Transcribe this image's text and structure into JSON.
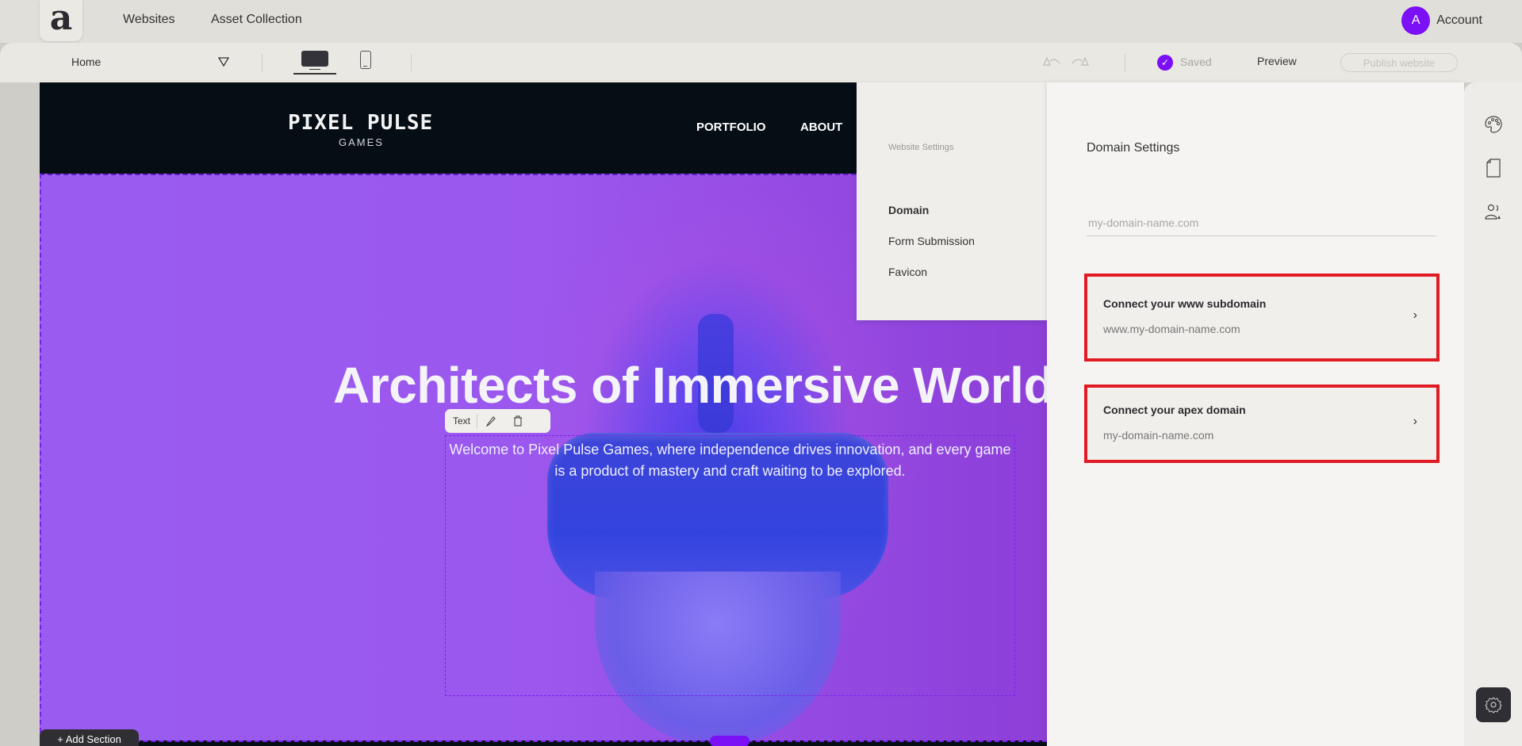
{
  "topnav": {
    "logo_glyph": "a",
    "links": [
      {
        "label": "Websites"
      },
      {
        "label": "Asset Collection"
      }
    ],
    "account": {
      "avatar_initial": "A",
      "label": "Account",
      "avatar_color": "#7b0ff5"
    }
  },
  "toolbar": {
    "page_select": "Home",
    "devices": [
      {
        "name": "desktop",
        "selected": true
      },
      {
        "name": "mobile",
        "selected": false
      }
    ],
    "undo_icon": "undo-icon",
    "redo_icon": "redo-icon",
    "saved_label": "Saved",
    "preview_label": "Preview",
    "publish_label": "Publish website",
    "publish_enabled": false
  },
  "canvas": {
    "site": {
      "logo_main": "PIXEL PULSE",
      "logo_sub": "GAMES",
      "nav": [
        "PORTFOLIO",
        "ABOUT"
      ]
    },
    "hero": {
      "title": "Architects of Immersive Worlds",
      "subtitle": "Welcome to Pixel Pulse Games, where independence drives innovation, and every game is a product of mastery and craft waiting to be explored."
    },
    "text_toolbar": {
      "label": "Text",
      "edit_icon": "pencil-icon",
      "delete_icon": "trash-icon"
    },
    "add_section_label": "+ Add Section"
  },
  "settings": {
    "heading": "Website Settings",
    "items": [
      {
        "label": "Domain",
        "active": true
      },
      {
        "label": "Form Submission",
        "active": false
      },
      {
        "label": "Favicon",
        "active": false
      }
    ],
    "domain": {
      "title": "Domain Settings",
      "input_value": "",
      "input_placeholder": "my-domain-name.com",
      "cards": [
        {
          "title": "Connect your www subdomain",
          "subtitle": "www.my-domain-name.com"
        },
        {
          "title": "Connect your apex domain",
          "subtitle": "my-domain-name.com"
        }
      ],
      "highlight_color": "#e01b24"
    }
  },
  "icon_rail": {
    "icons": [
      "palette-icon",
      "page-icon",
      "users-icon"
    ],
    "bottom_icon": "gear-icon"
  },
  "colors": {
    "accent": "#7b0ff5",
    "site_header": "#050d15",
    "hero_purple": "#9b57ee"
  }
}
